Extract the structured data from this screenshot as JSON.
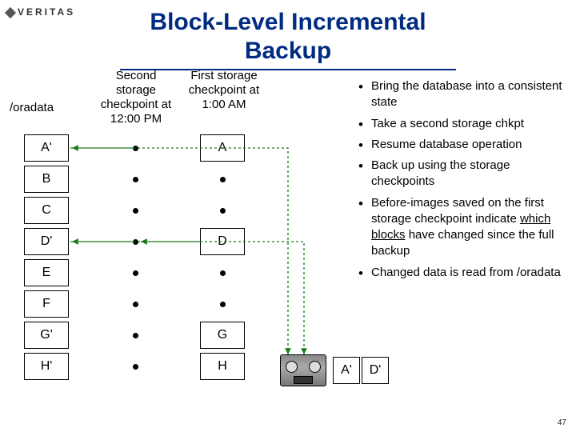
{
  "brand": "VERITAS",
  "title_line1": "Block-Level Incremental",
  "title_line2": "Backup",
  "labels": {
    "oradata": "/oradata",
    "second_cp": "Second\nstorage\ncheckpoint at\n12:00 PM",
    "first_cp": "First storage\ncheckpoint at\n1:00 AM"
  },
  "col1": [
    "A'",
    "B",
    "C",
    "D'",
    "E",
    "F",
    "G'",
    "H'"
  ],
  "col3": [
    "A",
    "",
    "",
    "D",
    "",
    "",
    "G",
    "H"
  ],
  "bullets": [
    "Bring the database into a consistent state",
    "Take a second storage chkpt",
    "Resume database operation",
    "Back up using the storage checkpoints",
    "Before-images saved on the first storage checkpoint indicate <u>which blocks</u> have changed since the full backup",
    "Changed data is read from /oradata"
  ],
  "tape_labels": [
    "A'",
    "D'"
  ],
  "page_number": "47"
}
